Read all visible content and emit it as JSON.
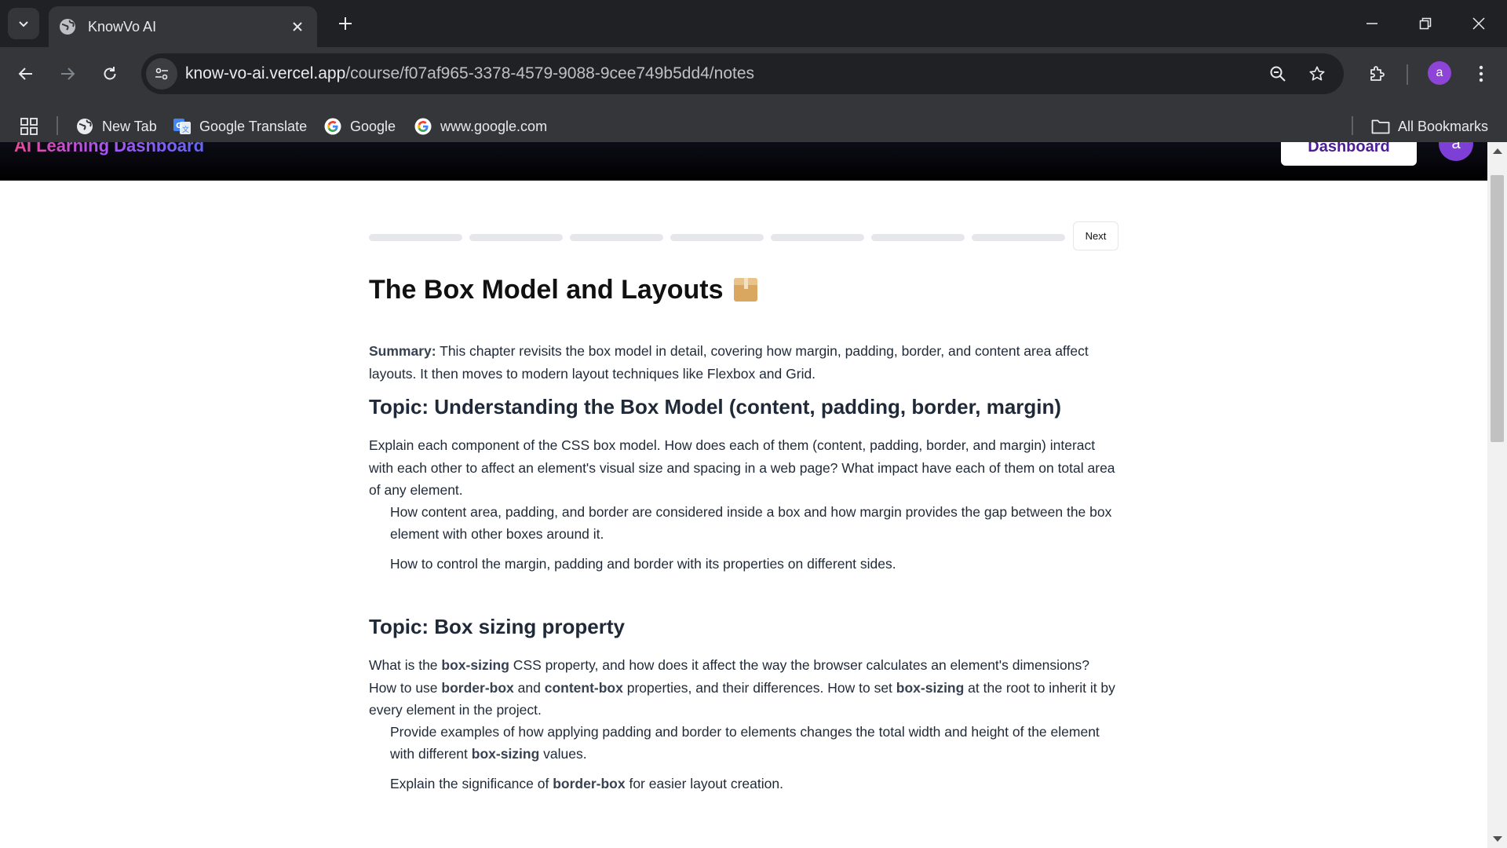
{
  "browser": {
    "tab_title": "KnowVo AI",
    "url_host": "know-vo-ai.vercel.app",
    "url_path": "/course/f07af965-3378-4579-9088-9cee749b5dd4/notes",
    "profile_initial": "a",
    "bookmarks": [
      {
        "label": "New Tab",
        "icon": "globe-icon"
      },
      {
        "label": "Google Translate",
        "icon": "google-translate-icon"
      },
      {
        "label": "Google",
        "icon": "google-icon"
      },
      {
        "label": "www.google.com",
        "icon": "google-icon"
      }
    ],
    "all_bookmarks": "All Bookmarks"
  },
  "app": {
    "title": "AI Learning Dashboard",
    "dashboard_button": "Dashboard",
    "avatar_initial": "a",
    "progress": {
      "current": 0,
      "total": 7
    },
    "next_button": "Next"
  },
  "chapter": {
    "title": "The Box Model and Layouts",
    "summary_label": "Summary:",
    "summary_text": " This chapter revisits the box model in detail, covering how margin, padding, border, and content area affect layouts. It then moves to modern layout techniques like Flexbox and Grid.",
    "topic1": {
      "heading": "Topic: Understanding the Box Model (content, padding, border, margin)",
      "body": "Explain each component of the CSS box model. How does each of them (content, padding, border, and margin) interact with each other to affect an element's visual size and spacing in a web page? What impact have each of them on total area of any element.",
      "bullets": [
        "How content area, padding, and border are considered inside a box and how margin provides the gap between the box element with other boxes around it.",
        "How to control the margin, padding and border with its properties on different sides."
      ]
    },
    "topic2": {
      "heading": "Topic: Box sizing property",
      "body": {
        "t1": "What is the ",
        "b1": "box-sizing",
        "t2": " CSS property, and how does it affect the way the browser calculates an element's dimensions? How to use ",
        "b2": "border-box",
        "t3": " and ",
        "b3": "content-box",
        "t4": " properties, and their differences. How to set ",
        "b4": "box-sizing",
        "t5": " at the root to inherit it by every element in the project."
      },
      "bullet1": {
        "t1": "Provide examples of how applying padding and border to elements changes the total width and height of the element with different ",
        "b1": "box-sizing",
        "t2": " values."
      },
      "bullet2": {
        "t1": "Explain the significance of ",
        "b1": "border-box",
        "t2": " for easier layout creation."
      }
    }
  }
}
